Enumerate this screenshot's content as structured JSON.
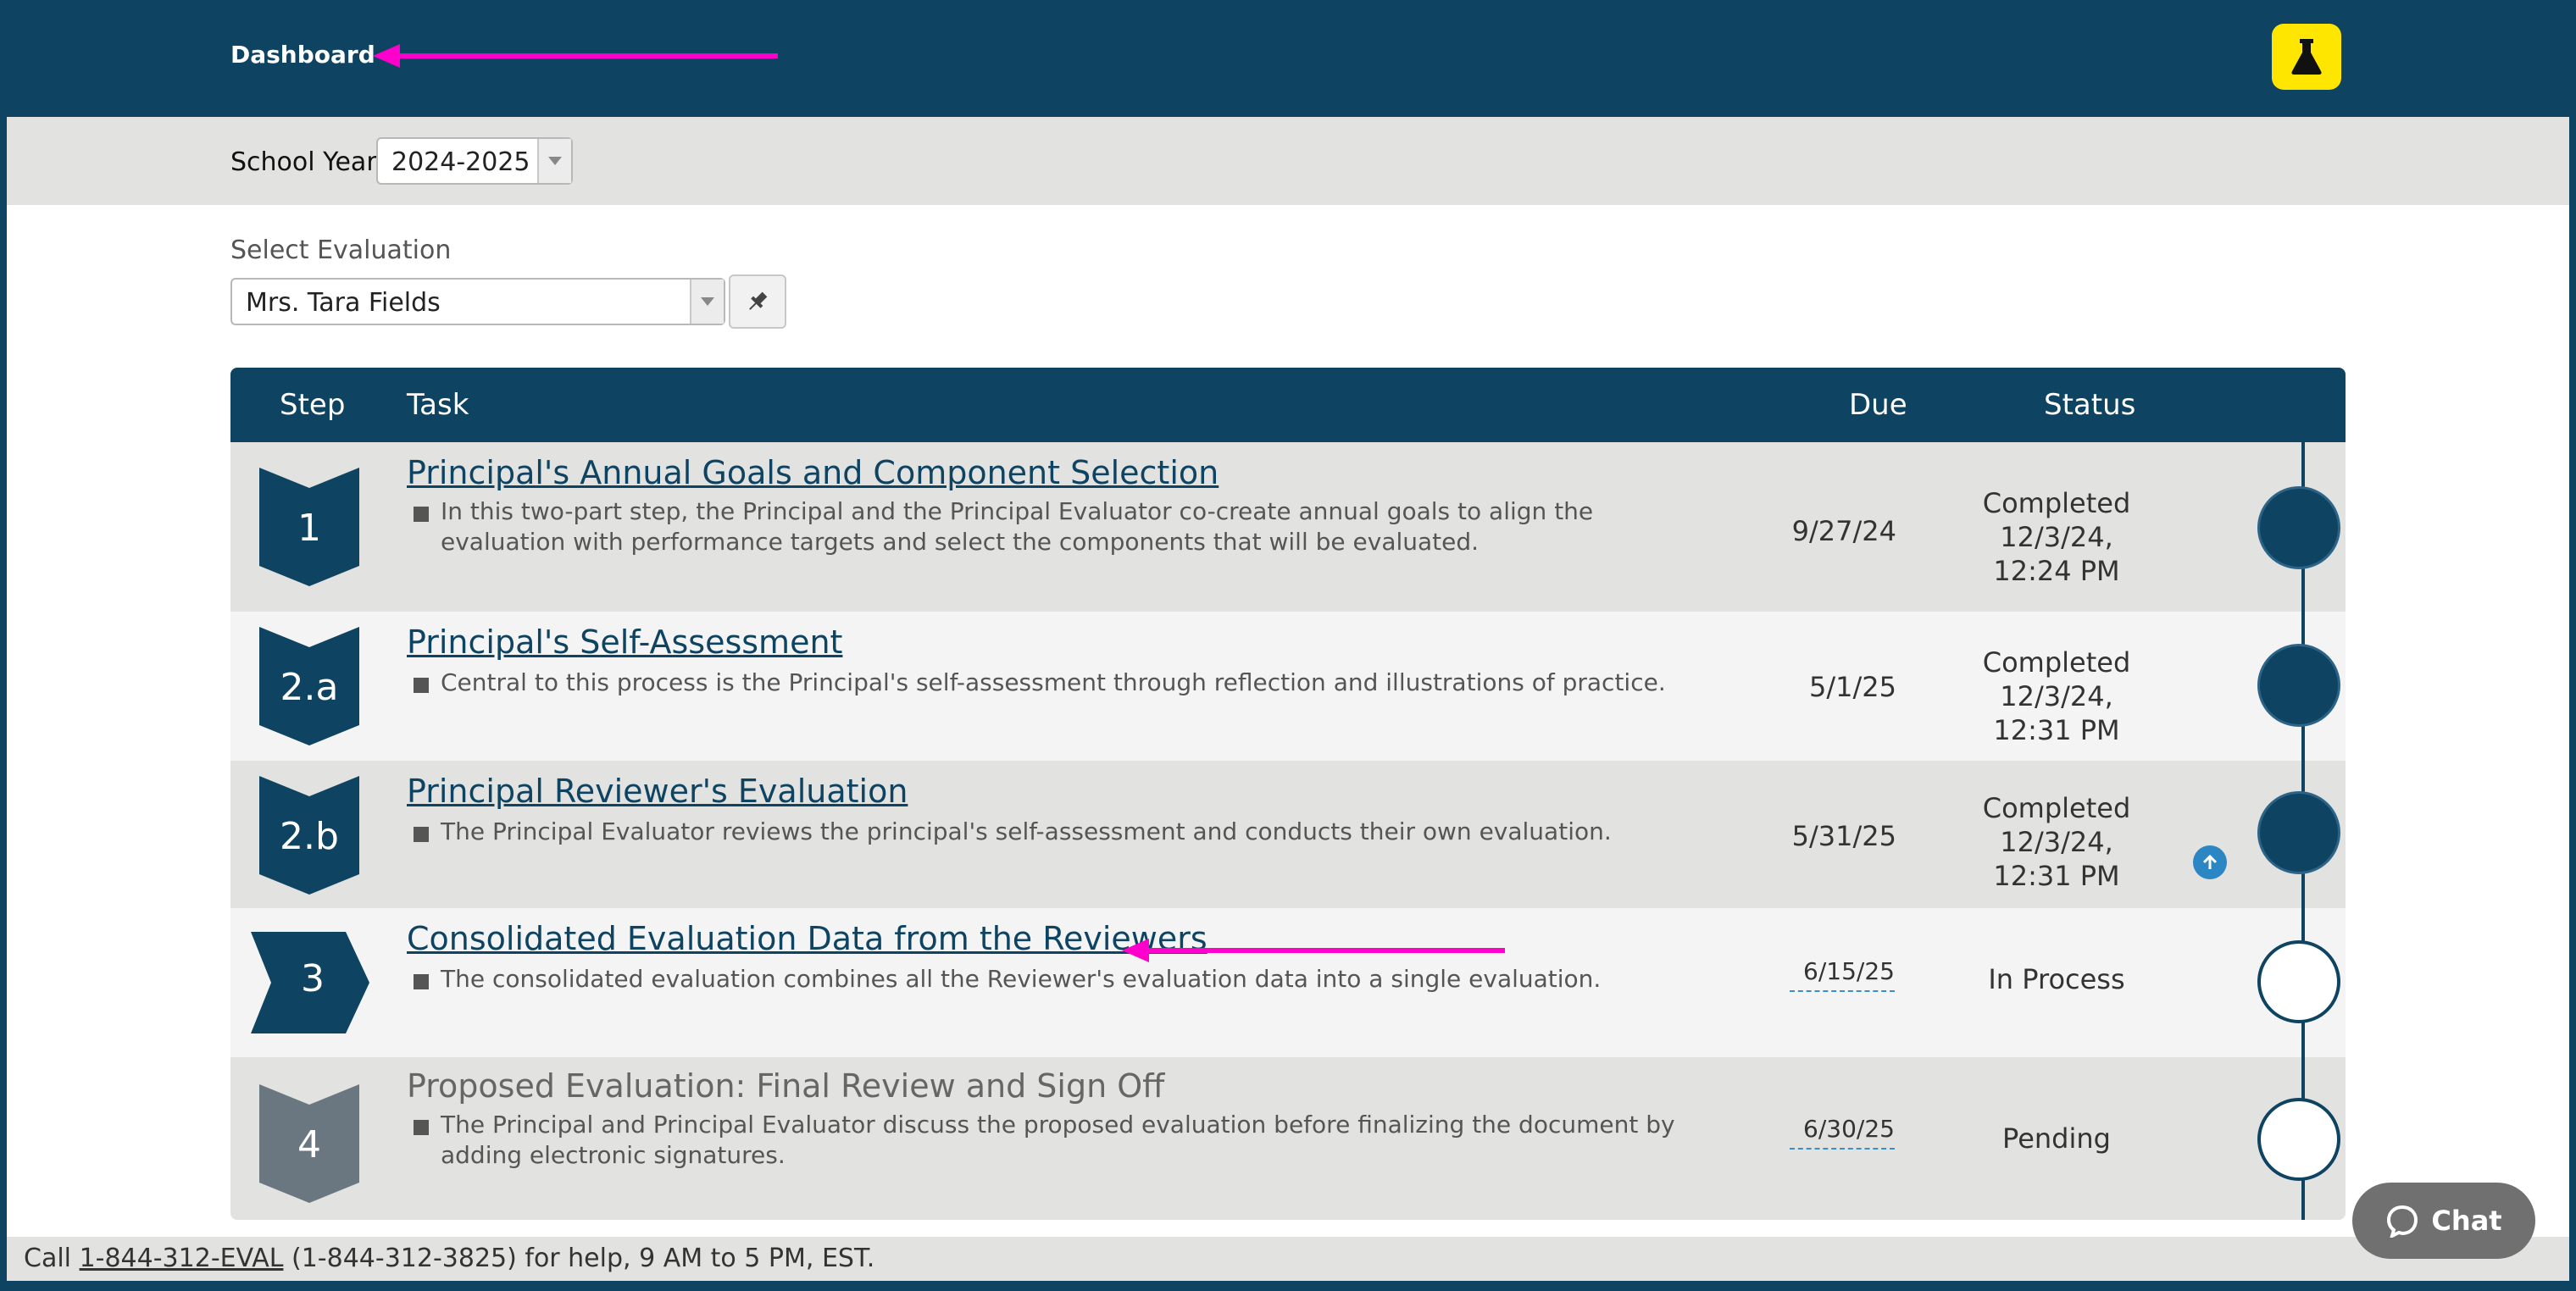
{
  "header": {
    "title": "Dashboard",
    "beaker_icon": "beaker-icon"
  },
  "school_year": {
    "label": "School Year:",
    "value": "2024-2025"
  },
  "evaluation": {
    "label": "Select Evaluation",
    "value": "Mrs. Tara Fields",
    "pin_icon": "pin-icon"
  },
  "table": {
    "columns": {
      "step": "Step",
      "task": "Task",
      "due": "Due",
      "status": "Status"
    },
    "rows": [
      {
        "step": "1",
        "title": "Principal's Annual Goals and Component Selection",
        "description": "In this two-part step, the Principal and the Principal Evaluator co-create annual goals to align the evaluation with performance targets and select the components that will be evaluated.",
        "due": "9/27/24",
        "status_line1": "Completed 12/3/24,",
        "status_line2": "12:24 PM"
      },
      {
        "step": "2.a",
        "title": "Principal's Self-Assessment",
        "description": "Central to this process is the Principal's self-assessment through reflection and illustrations of practice.",
        "due": "5/1/25",
        "status_line1": "Completed 12/3/24,",
        "status_line2": "12:31 PM"
      },
      {
        "step": "2.b",
        "title": "Principal Reviewer's Evaluation",
        "description": "The Principal Evaluator reviews the principal's self-assessment and conducts their own evaluation.",
        "due": "5/31/25",
        "status_line1": "Completed 12/3/24,",
        "status_line2": "12:31 PM"
      },
      {
        "step": "3",
        "title": "Consolidated Evaluation Data from the Reviewers",
        "description": "The consolidated evaluation combines all the Reviewer's evaluation data into a single evaluation.",
        "due": "6/15/25",
        "status_line1": "In Process",
        "status_line2": ""
      },
      {
        "step": "4",
        "title": "Proposed Evaluation: Final Review and Sign Off",
        "description": "The Principal and Principal Evaluator discuss the proposed evaluation before finalizing the document by adding electronic signatures.",
        "due": "6/30/25",
        "status_line1": "Pending",
        "status_line2": ""
      }
    ]
  },
  "footer": {
    "prefix": "Call",
    "phone_link": "1-844-312-EVAL",
    "suffix": "(1-844-312-3825) for help, 9 AM to 5 PM, EST."
  },
  "chat": {
    "label": "Chat",
    "icon": "chat-bubble-icon"
  },
  "colors": {
    "navy": "#0e4361",
    "annotation_magenta": "#ff00cc",
    "beaker_yellow": "#ffe600"
  }
}
